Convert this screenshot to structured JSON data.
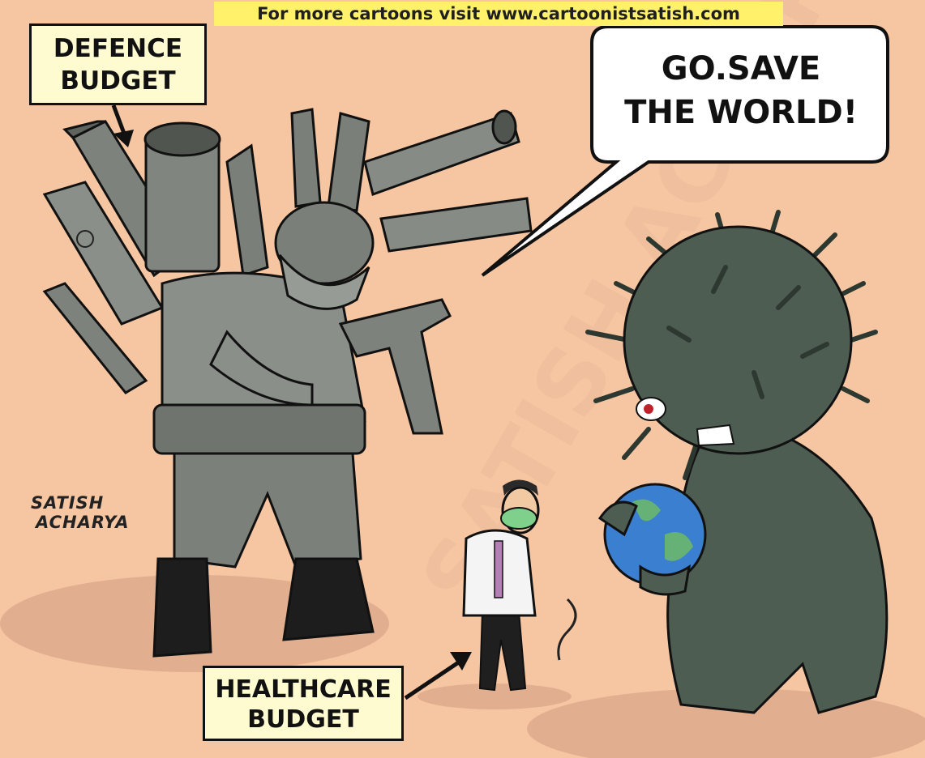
{
  "banner": {
    "text": "For more cartoons visit www.cartoonistsatish.com"
  },
  "labels": {
    "defence": {
      "line1": "DEFENCE",
      "line2": "BUDGET"
    },
    "healthcare": {
      "line1": "HEALTHCARE",
      "line2": "BUDGET"
    }
  },
  "speech_bubble": {
    "line1": "GO.SAVE",
    "line2": "THE WORLD!"
  },
  "signature": {
    "line1": "SATISH",
    "line2": "ACHARYA"
  },
  "colors": {
    "background": "#f6c6a2",
    "banner": "#fff26a",
    "label_fill": "#fffbd0",
    "soldier_gray": "#7f8580",
    "virus_green": "#4e5d52",
    "earth_blue": "#3b7fd0",
    "doctor_coat": "#f4f4f4",
    "mask_green": "#7fd08a"
  }
}
